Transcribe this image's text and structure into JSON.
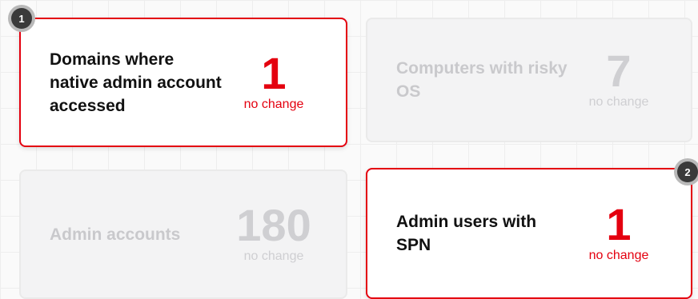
{
  "cards": [
    {
      "label": "Domains where native admin account accessed",
      "value": "1",
      "change": "no change",
      "highlighted": true,
      "step": "1"
    },
    {
      "label": "Computers with risky OS",
      "value": "7",
      "change": "no change",
      "highlighted": false
    },
    {
      "label": "Admin accounts",
      "value": "180",
      "change": "no change",
      "highlighted": false
    },
    {
      "label": "Admin users with SPN",
      "value": "1",
      "change": "no change",
      "highlighted": true,
      "step": "2"
    }
  ],
  "colors": {
    "accent": "#e4000f",
    "dim_text": "#c9c9cc",
    "badge": "#3a3a3a"
  }
}
